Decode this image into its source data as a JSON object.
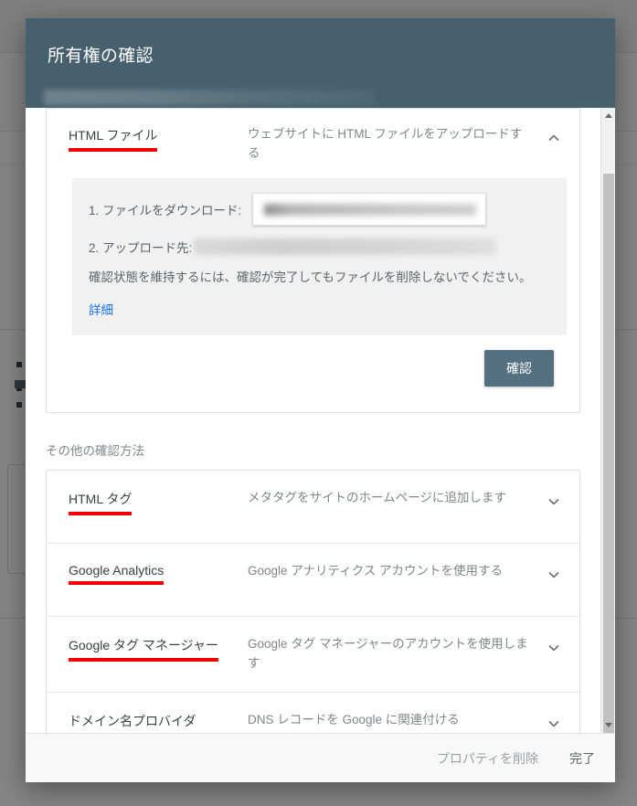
{
  "dialog": {
    "title": "所有権の確認",
    "subtitle_redacted": true,
    "expanded_method": {
      "name": "HTML ファイル",
      "description": "ウェブサイトに HTML ファイルをアップロードする",
      "expanded": true,
      "chevron": "chevron-up-icon",
      "annotated": true,
      "steps": [
        {
          "label": "1. ファイルをダウンロード:",
          "value_redacted": true,
          "control": "download-button"
        },
        {
          "label": "2. アップロード先:",
          "value_redacted": true,
          "control": "url-text"
        }
      ],
      "note": "確認状態を維持するには、確認が完了してもファイルを削除しないでください。",
      "details_link": "詳細",
      "verify_button": "確認"
    },
    "other_methods_heading": "その他の確認方法",
    "other_methods": [
      {
        "name": "HTML タグ",
        "description": "メタタグをサイトのホームページに追加します",
        "chevron": "chevron-down-icon",
        "annotated": true
      },
      {
        "name": "Google Analytics",
        "description": "Google アナリティクス アカウントを使用する",
        "chevron": "chevron-down-icon",
        "annotated": true
      },
      {
        "name": "Google タグ マネージャー",
        "description": "Google タグ マネージャーのアカウントを使用します",
        "chevron": "chevron-down-icon",
        "annotated": true
      },
      {
        "name": "ドメイン名プロバイダ",
        "description": "DNS レコードを Google に関連付ける",
        "chevron": "chevron-down-icon",
        "annotated": true
      }
    ],
    "footer": {
      "delete_property": "プロパティを削除",
      "done": "完了"
    },
    "scrollbar": {
      "up_arrow": "scroll-up-arrow-icon",
      "down_arrow": "scroll-down-arrow-icon"
    }
  },
  "colors": {
    "header_bg": "#46606e",
    "verify_button_bg": "#547081",
    "annotation_red": "#f40000",
    "link_blue": "#1a73e8",
    "muted_text": "#80868b"
  }
}
